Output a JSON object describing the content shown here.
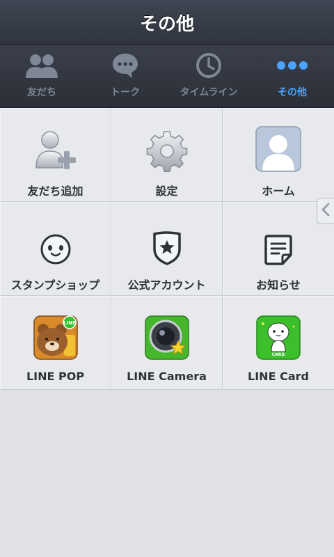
{
  "header": {
    "title": "その他"
  },
  "tabs": [
    {
      "label": "友だち",
      "icon": "friends-icon",
      "active": false
    },
    {
      "label": "トーク",
      "icon": "chat-icon",
      "active": false
    },
    {
      "label": "タイムライン",
      "icon": "clock-icon",
      "active": false
    },
    {
      "label": "その他",
      "icon": "more-dots-icon",
      "active": true
    }
  ],
  "menu": [
    {
      "label": "友だち追加",
      "icon": "add-friend-icon"
    },
    {
      "label": "設定",
      "icon": "gear-icon"
    },
    {
      "label": "ホーム",
      "icon": "profile-home-icon"
    },
    {
      "label": "スタンプショップ",
      "icon": "sticker-face-icon"
    },
    {
      "label": "公式アカウント",
      "icon": "official-shield-icon"
    },
    {
      "label": "お知らせ",
      "icon": "notice-icon"
    },
    {
      "label": "LINE POP",
      "icon": "line-pop-app-icon"
    },
    {
      "label": "LINE Camera",
      "icon": "line-camera-app-icon"
    },
    {
      "label": "LINE Card",
      "icon": "line-card-app-icon"
    }
  ],
  "app_badges": {
    "line_pop_badge": "LINE",
    "line_card_badge": "CARD"
  },
  "colors": {
    "active_tab": "#4aa3ff",
    "inactive_tab": "#7e8795",
    "line_green": "#35c22a"
  }
}
